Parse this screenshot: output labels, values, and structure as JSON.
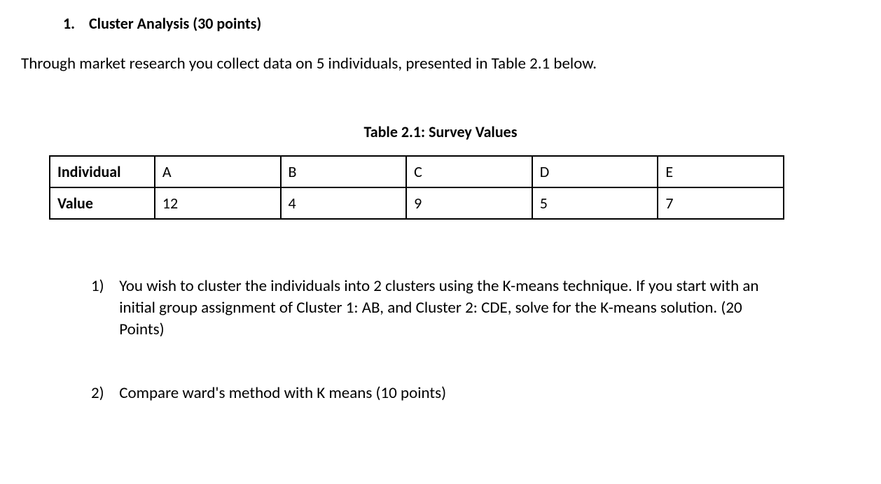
{
  "heading": {
    "number": "1.",
    "title": "Cluster Analysis (30 points)"
  },
  "intro": "Through market research you collect data on 5 individuals, presented in Table 2.1 below.",
  "table": {
    "caption": "Table 2.1: Survey Values",
    "rows": [
      {
        "label": "Individual",
        "cells": [
          "A",
          "B",
          "C",
          "D",
          "E"
        ]
      },
      {
        "label": "Value",
        "cells": [
          "12",
          "4",
          "9",
          "5",
          "7"
        ]
      }
    ]
  },
  "subquestions": [
    {
      "number": "1)",
      "text": "You wish to cluster the individuals into 2 clusters using the K-means technique.  If you start with an initial group assignment of Cluster 1: AB, and Cluster 2: CDE, solve for the K-means solution. (20 Points)"
    },
    {
      "number": "2)",
      "text": "Compare ward's method with K means (10 points)"
    }
  ]
}
